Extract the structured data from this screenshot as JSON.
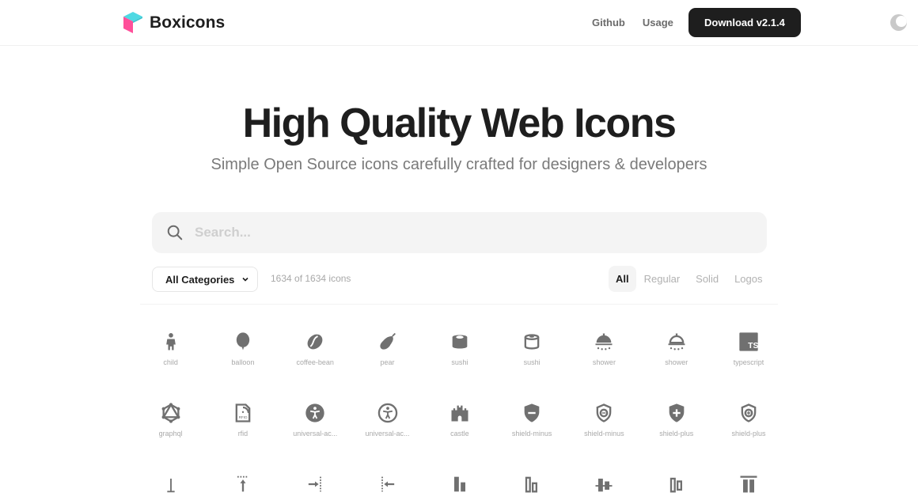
{
  "header": {
    "brand": "Boxicons",
    "nav": [
      "Github",
      "Usage"
    ],
    "download_label": "Download v2.1.4",
    "theme_toggle": "moon-icon"
  },
  "hero": {
    "title": "High Quality Web Icons",
    "subtitle": "Simple Open Source icons carefully crafted for designers & developers"
  },
  "search": {
    "placeholder": "Search...",
    "value": ""
  },
  "filters": {
    "category": "All Categories",
    "count_text": "1634 of 1634 icons",
    "types": [
      "All",
      "Regular",
      "Solid",
      "Logos"
    ],
    "active_type": "All"
  },
  "icons": [
    {
      "name": "child",
      "icon": "child-icon"
    },
    {
      "name": "balloon",
      "icon": "balloon-icon"
    },
    {
      "name": "coffee-bean",
      "icon": "coffee-bean-icon"
    },
    {
      "name": "pear",
      "icon": "pear-icon"
    },
    {
      "name": "sushi",
      "icon": "sushi-solid-icon"
    },
    {
      "name": "sushi",
      "icon": "sushi-regular-icon"
    },
    {
      "name": "shower",
      "icon": "shower-solid-icon"
    },
    {
      "name": "shower",
      "icon": "shower-regular-icon"
    },
    {
      "name": "typescript",
      "icon": "typescript-icon"
    },
    {
      "name": "graphql",
      "icon": "graphql-icon"
    },
    {
      "name": "rfid",
      "icon": "rfid-icon"
    },
    {
      "name": "universal-ac...",
      "icon": "universal-access-solid-icon"
    },
    {
      "name": "universal-ac...",
      "icon": "universal-access-regular-icon"
    },
    {
      "name": "castle",
      "icon": "castle-icon"
    },
    {
      "name": "shield-minus",
      "icon": "shield-minus-solid-icon"
    },
    {
      "name": "shield-minus",
      "icon": "shield-minus-regular-icon"
    },
    {
      "name": "shield-plus",
      "icon": "shield-plus-solid-icon"
    },
    {
      "name": "shield-plus",
      "icon": "shield-plus-regular-icon"
    },
    {
      "name": "",
      "icon": "vertical-bottom-icon"
    },
    {
      "name": "",
      "icon": "vertical-top-icon"
    },
    {
      "name": "",
      "icon": "horizontal-right-icon"
    },
    {
      "name": "",
      "icon": "horizontal-left-icon"
    },
    {
      "name": "",
      "icon": "align-bottom-solid-icon"
    },
    {
      "name": "",
      "icon": "align-bottom-regular-icon"
    },
    {
      "name": "",
      "icon": "align-middle-solid-icon"
    },
    {
      "name": "",
      "icon": "align-middle-regular-icon"
    },
    {
      "name": "",
      "icon": "align-top-icon"
    }
  ]
}
